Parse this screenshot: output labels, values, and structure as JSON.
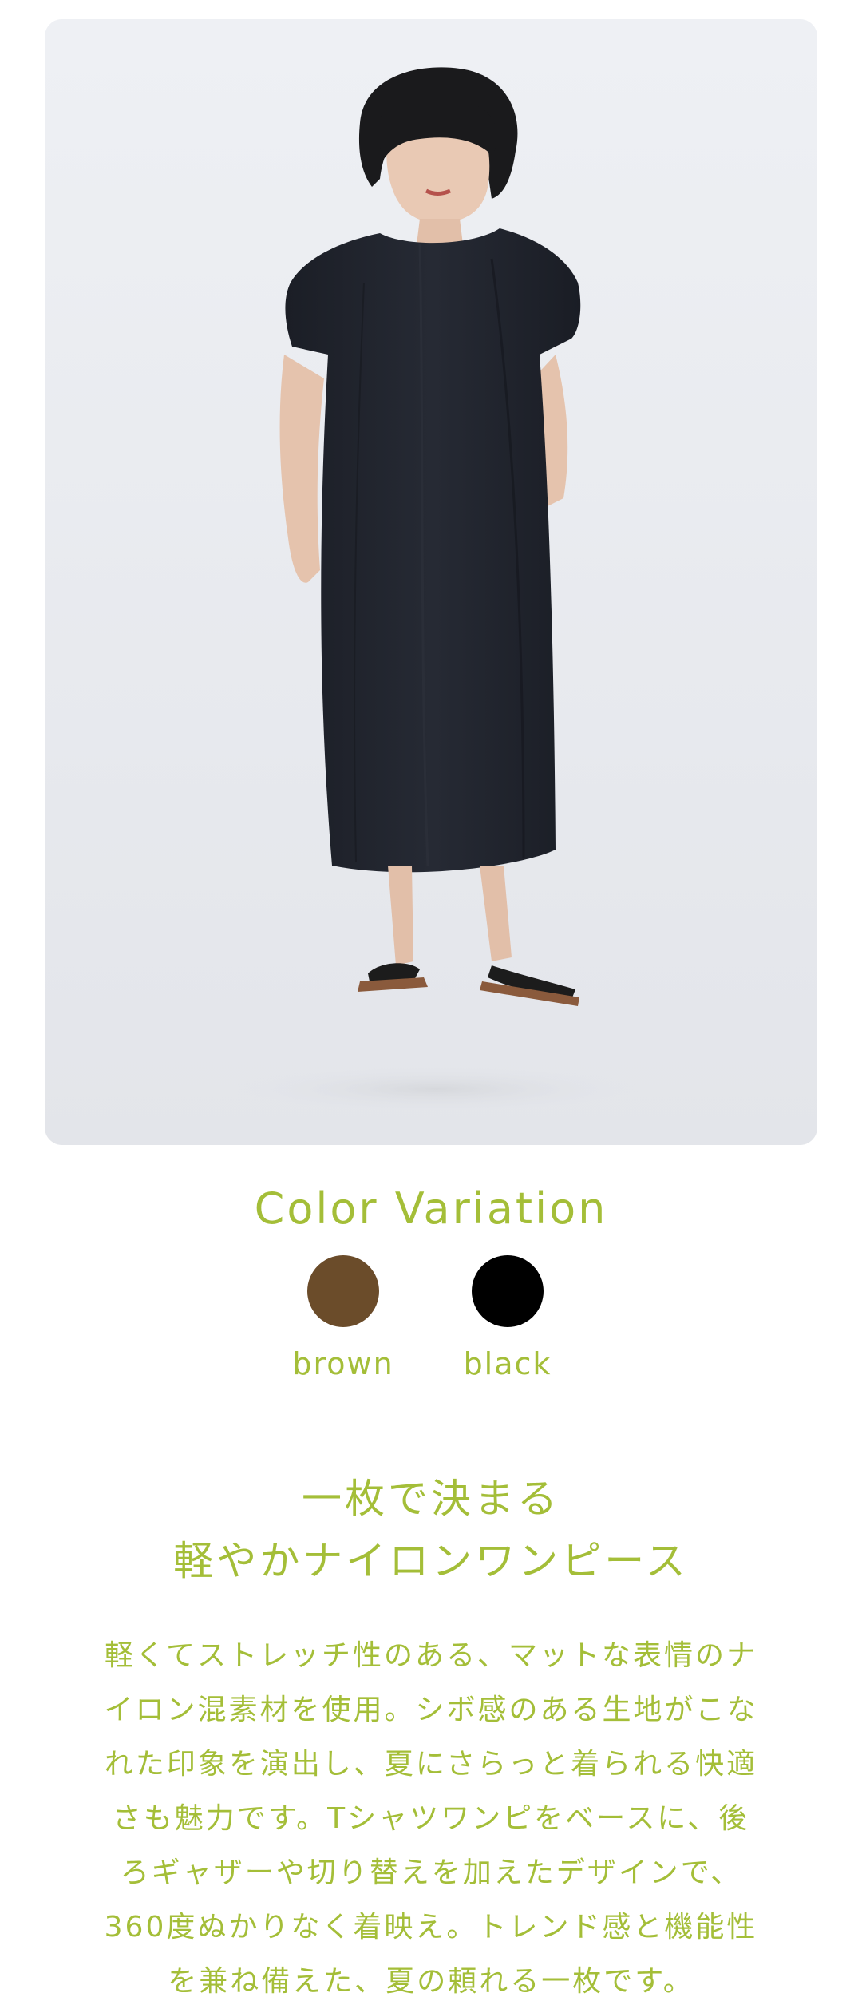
{
  "colors": {
    "accent": "#a4be38",
    "brown": "#6b4c2a",
    "black": "#000000",
    "dress": "#1f222b",
    "background": "#ffffff"
  },
  "product_image": {
    "icon": "model-wearing-black-dress-image"
  },
  "color_variation": {
    "title": "Color Variation",
    "options": [
      {
        "label": "brown",
        "color": "#6b4c2a"
      },
      {
        "label": "black",
        "color": "#000000"
      }
    ]
  },
  "headline": {
    "line1": "一枚で決まる",
    "line2": "軽やかナイロンワンピース"
  },
  "description": {
    "lines": [
      "軽くてストレッチ性のある、マットな表情のナ",
      "イロン混素材を使用。シボ感のある生地がこな",
      "れた印象を演出し、夏にさらっと着られる快適",
      "さも魅力です。Tシャツワンピをベースに、後",
      "ろギャザーや切り替えを加えたデザインで、",
      "360度ぬかりなく着映え。トレンド感と機能性",
      "を兼ね備えた、夏の頼れる一枚です。"
    ]
  }
}
